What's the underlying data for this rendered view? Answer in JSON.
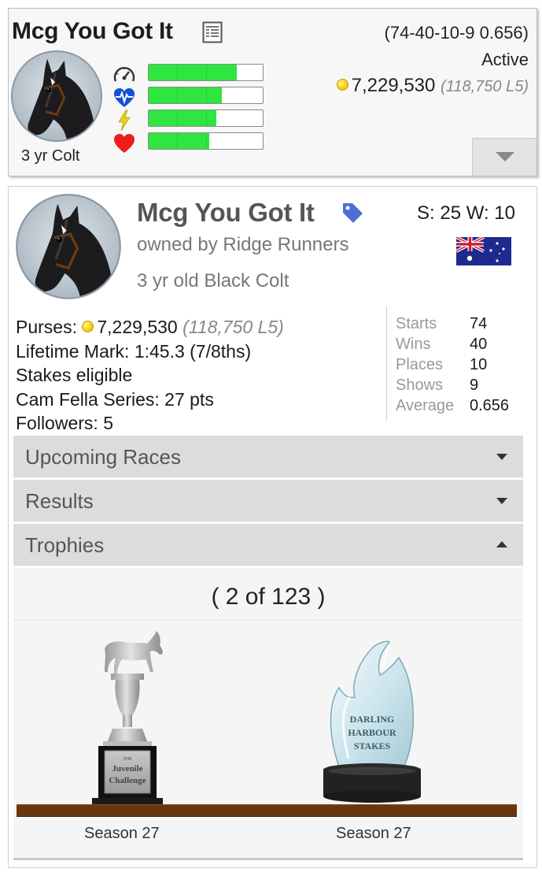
{
  "summary_card": {
    "horse_name": "Mcg You Got It",
    "record": "(74-40-10-9 0.656)",
    "status": "Active",
    "purse": "7,229,530",
    "purse_l5": "(118,750 L5)",
    "age_sex": "3 yr Colt",
    "stat_bars": [
      {
        "icon": "speedometer-icon",
        "fill": 0.77
      },
      {
        "icon": "heart-pulse-icon",
        "fill": 0.64
      },
      {
        "icon": "lightning-icon",
        "fill": 0.59
      },
      {
        "icon": "heart-icon",
        "fill": 0.53
      }
    ],
    "colors": {
      "bar_fill": "#2ee63f",
      "coin": "#ffd81a"
    }
  },
  "profile": {
    "horse_name": "Mcg You Got It",
    "owner": "owned by Ridge Runners",
    "description": "3 yr old Black Colt",
    "sw": "S: 25 W: 10",
    "flag": "australia-flag-icon",
    "details": {
      "purses_label": "Purses:",
      "purses_value": "7,229,530",
      "purses_l5": "(118,750 L5)",
      "lifetime_mark": "Lifetime Mark: 1:45.3 (7/8ths)",
      "stakes": "Stakes eligible",
      "series": "Cam Fella Series: 27 pts",
      "followers": "Followers: 5"
    },
    "stats": [
      {
        "label": "Starts",
        "value": "74"
      },
      {
        "label": "Wins",
        "value": "40"
      },
      {
        "label": "Places",
        "value": "10"
      },
      {
        "label": "Shows",
        "value": "9"
      },
      {
        "label": "Average",
        "value": "0.656"
      }
    ],
    "sections": {
      "upcoming": "Upcoming Races",
      "results": "Results",
      "trophies": "Trophies"
    },
    "trophies": {
      "count": "( 2 of 123 )",
      "items": [
        {
          "name": "THE Juvenile Challenge",
          "line1": "THE",
          "line2": "Juvenile",
          "line3": "Challenge",
          "season": "Season 27"
        },
        {
          "name": "DARLING HARBOUR STAKES",
          "line1": "DARLING",
          "line2": "HARBOUR",
          "line3": "STAKES",
          "season": "Season 27"
        }
      ]
    }
  }
}
